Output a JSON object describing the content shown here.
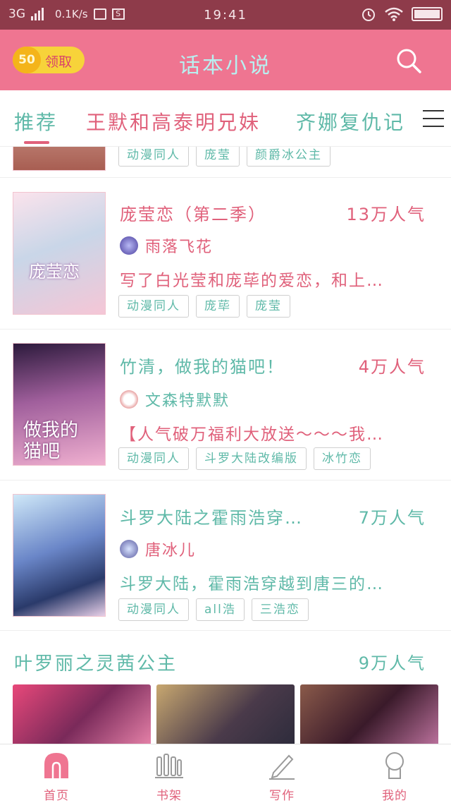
{
  "status_bar": {
    "network": "3G",
    "speed": "0.1K/s",
    "time": "19:41"
  },
  "header": {
    "coins": "50",
    "claim_label": "领取",
    "title": "话本小说"
  },
  "tabs": [
    {
      "label": "推荐"
    },
    {
      "label": "王默和高泰明兄妹"
    },
    {
      "label": "齐娜复仇记"
    }
  ],
  "partial_item": {
    "tags": [
      "动漫同人",
      "庞莹",
      "颜爵冰公主"
    ]
  },
  "items": [
    {
      "title": "庞莹恋（第二季）",
      "popularity": "13万人气",
      "author": "雨落飞花",
      "description": "写了白光莹和庞荜的爱恋，和上…",
      "tags": [
        "动漫同人",
        "庞荜",
        "庞莹"
      ],
      "title_color": "#e0617b",
      "cover_text": "庞莹恋"
    },
    {
      "title": "竹清，做我的猫吧！",
      "popularity": "4万人气",
      "author": "文森特默默",
      "description": "【人气破万福利大放送～～～我…",
      "tags": [
        "动漫同人",
        "斗罗大陆改编版",
        "冰竹恋"
      ],
      "title_color": "#5fb9a8",
      "cover_text": "做我的猫吧"
    },
    {
      "title": "斗罗大陆之霍雨浩穿…",
      "popularity": "7万人气",
      "author": "唐冰儿",
      "description": "斗罗大陆，霍雨浩穿越到唐三的…",
      "tags": [
        "动漫同人",
        "all浩",
        "三浩恋"
      ],
      "title_color": "#5fb9a8",
      "cover_text": ""
    }
  ],
  "section": {
    "title": "叶罗丽之灵茜公主",
    "popularity": "9万人气"
  },
  "bottom_nav": [
    {
      "label": "首页",
      "icon": "home-icon"
    },
    {
      "label": "书架",
      "icon": "bookshelf-icon"
    },
    {
      "label": "写作",
      "icon": "pencil-icon"
    },
    {
      "label": "我的",
      "icon": "profile-icon"
    }
  ],
  "colors": {
    "header_bg": "#ef7591",
    "status_bar_bg": "#8e3b4a",
    "accent_pink": "#e0617b",
    "accent_teal": "#5fb9a8",
    "coin_yellow": "#f7d33a"
  }
}
